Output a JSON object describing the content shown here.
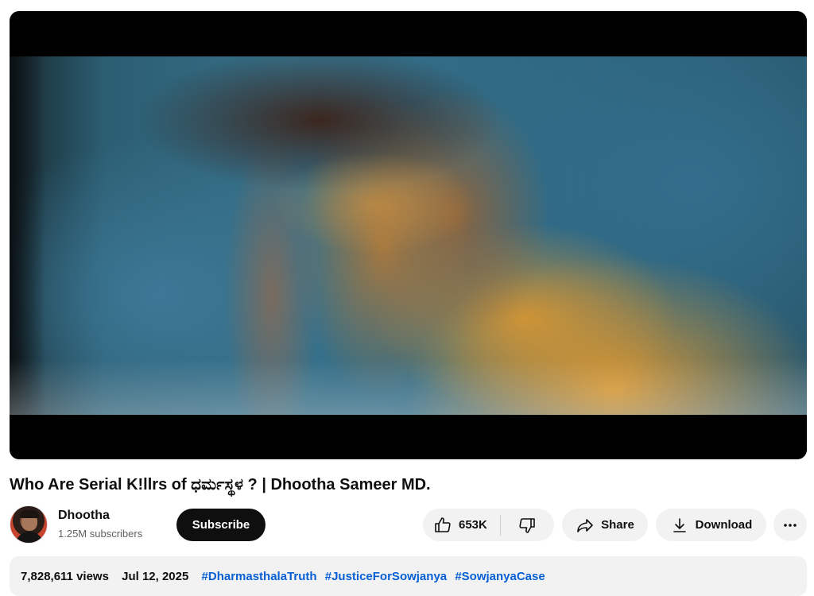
{
  "video": {
    "title": "Who Are Serial K!llrs of ಧರ್ಮಸ್ಥಳ ? | Dhootha Sameer MD."
  },
  "channel": {
    "name": "Dhootha",
    "subscribers": "1.25M subscribers",
    "subscribe_label": "Subscribe"
  },
  "actions": {
    "like_count": "653K",
    "share_label": "Share",
    "download_label": "Download"
  },
  "description": {
    "views": "7,828,611 views",
    "date": "Jul 12, 2025",
    "hashtags": [
      "#DharmasthalaTruth",
      "#JusticeForSowjanya",
      "#SowjanyaCase"
    ]
  },
  "icons": {
    "like": "thumbs-up-icon",
    "dislike": "thumbs-down-icon",
    "share": "share-arrow-icon",
    "download": "download-icon",
    "more": "more-horizontal-icon"
  },
  "colors": {
    "subscribe_bg": "#0f0f0f",
    "pill_bg": "#f2f2f2",
    "hashtag": "#065fd4"
  }
}
